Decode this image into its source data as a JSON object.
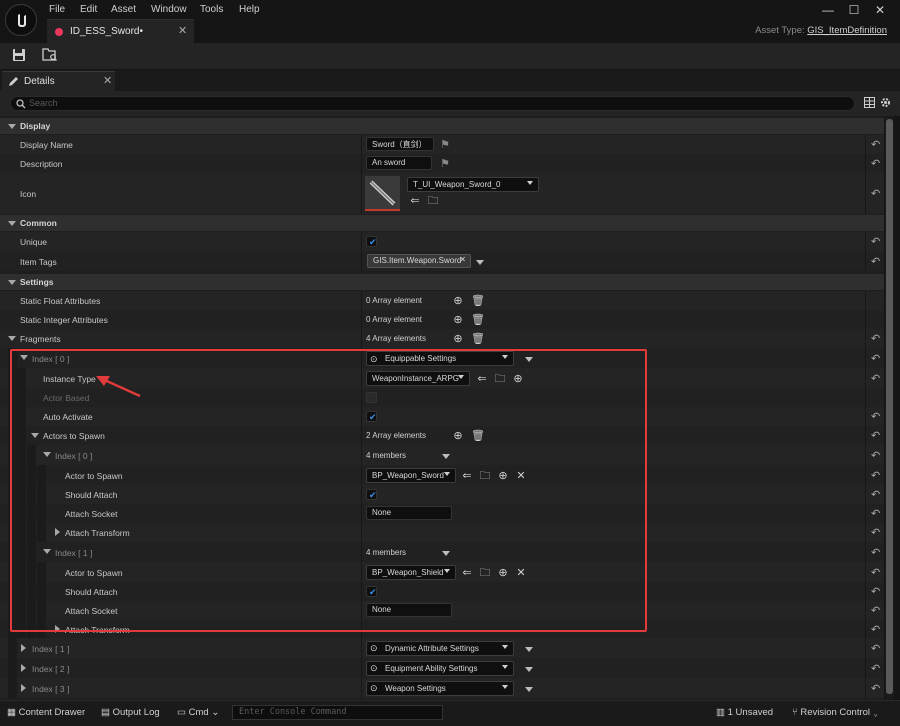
{
  "menu": [
    "File",
    "Edit",
    "Asset",
    "Window",
    "Tools",
    "Help"
  ],
  "window_controls": {
    "minimize": "—",
    "maximize": "☐",
    "close": "✕"
  },
  "document_tab": {
    "label": "ID_ESS_Sword•"
  },
  "asset_type": {
    "label": "Asset Type:",
    "value": "GIS_ItemDefinition"
  },
  "details_tab": {
    "label": "Details"
  },
  "search": {
    "placeholder": "Search"
  },
  "colors": {
    "accent_check": "#3b8ee8",
    "annotation": "#e23b3b",
    "doc_dot": "#e9385a"
  },
  "display": {
    "category": "Display",
    "display_name_label": "Display Name",
    "display_name_value": "Sword（直剑）",
    "description_label": "Description",
    "description_value": "An sword",
    "icon_label": "Icon",
    "icon_value": "T_UI_Weapon_Sword_0"
  },
  "common": {
    "category": "Common",
    "unique_label": "Unique",
    "unique_checked": true,
    "item_tags_label": "Item Tags",
    "item_tag": "GIS.Item.Weapon.Sword"
  },
  "settings": {
    "category": "Settings",
    "static_float_label": "Static Float Attributes",
    "static_float_value": "0 Array element",
    "static_int_label": "Static Integer Attributes",
    "static_int_value": "0 Array element",
    "fragments_label": "Fragments",
    "fragments_value": "4 Array elements"
  },
  "fragment0": {
    "label": "Index [ 0 ]",
    "type": "Equippable Settings",
    "instance_type_label": "Instance Type",
    "instance_type_value": "WeaponInstance_ARPG",
    "actor_based_label": "Actor Based",
    "auto_activate_label": "Auto Activate",
    "actors_to_spawn_label": "Actors to Spawn",
    "actors_to_spawn_value": "2 Array elements",
    "actor0": {
      "label": "Index [ 0 ]",
      "members": "4 members",
      "actor_to_spawn_label": "Actor to Spawn",
      "actor_to_spawn_value": "BP_Weapon_Sword",
      "should_attach_label": "Should Attach",
      "attach_socket_label": "Attach Socket",
      "attach_socket_value": "None",
      "attach_transform_label": "Attach Transform"
    },
    "actor1": {
      "label": "Index [ 1 ]",
      "members": "4 members",
      "actor_to_spawn_label": "Actor to Spawn",
      "actor_to_spawn_value": "BP_Weapon_Shield",
      "should_attach_label": "Should Attach",
      "attach_socket_label": "Attach Socket",
      "attach_socket_value": "None",
      "attach_transform_label": "Attach Transform"
    }
  },
  "fragment1": {
    "label": "Index [ 1 ]",
    "type": "Dynamic Attribute Settings"
  },
  "fragment2": {
    "label": "Index [ 2 ]",
    "type": "Equipment Ability Settings"
  },
  "fragment3": {
    "label": "Index [ 3 ]",
    "type": "Weapon Settings"
  },
  "statusbar": {
    "content_drawer": "Content Drawer",
    "output_log": "Output Log",
    "cmd": "Cmd",
    "console_placeholder": "Enter Console Command",
    "unsaved": "1 Unsaved",
    "revision_control": "Revision Control"
  }
}
